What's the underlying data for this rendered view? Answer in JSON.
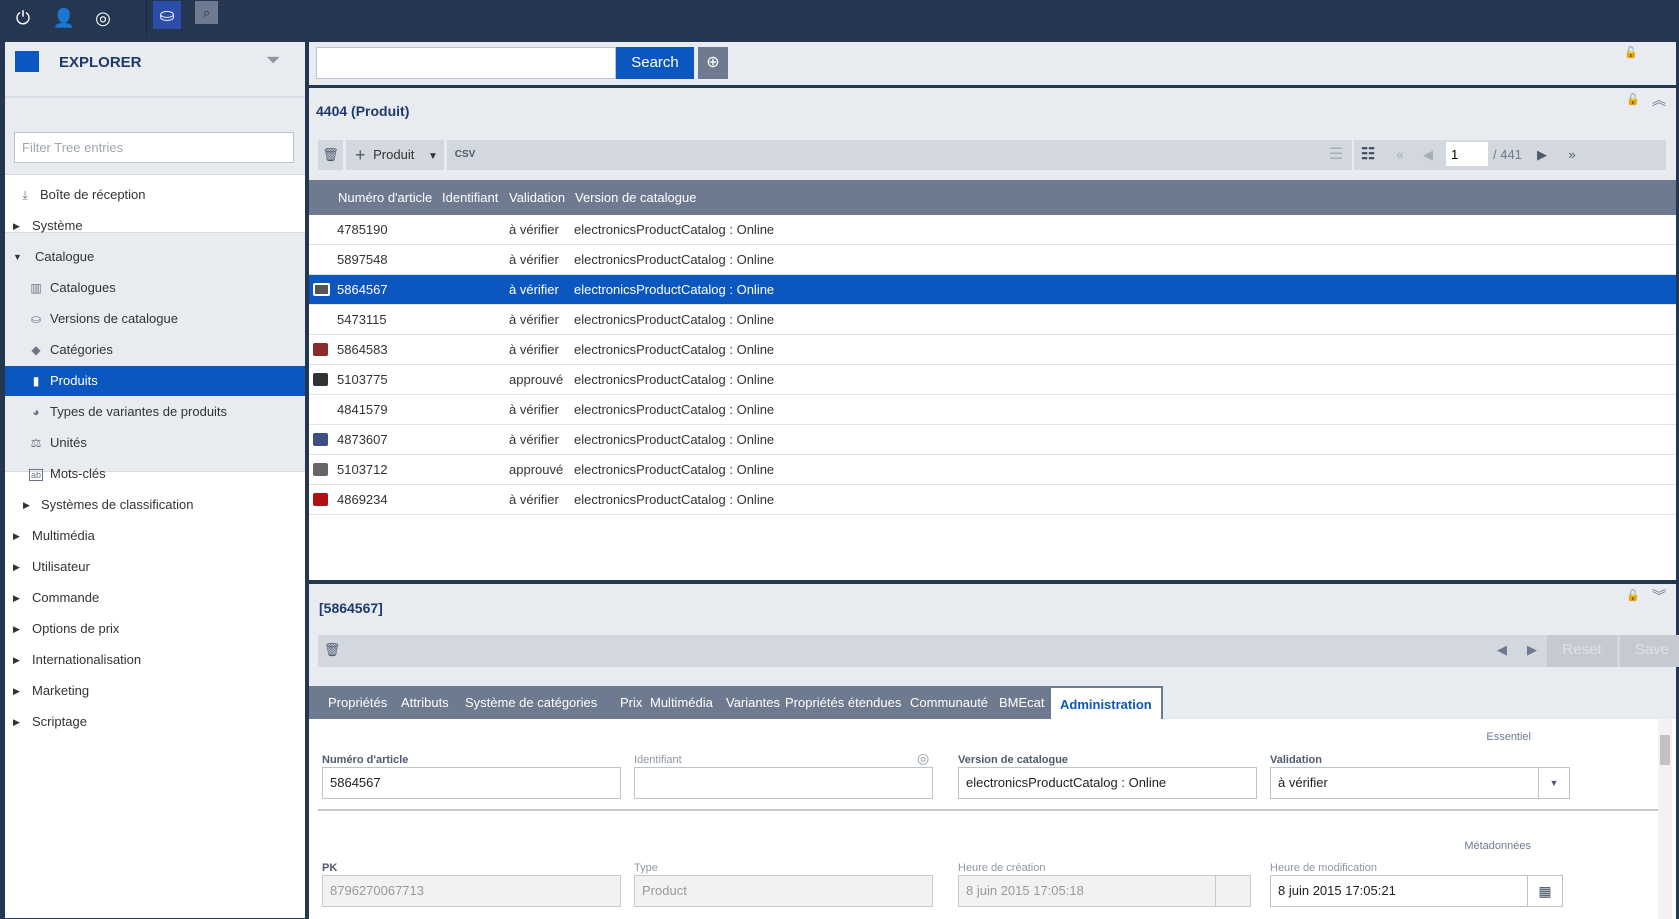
{
  "topbar": {
    "icons": [
      "power-icon",
      "user-icon",
      "globe-icon",
      "backoffice-perspective-icon",
      "search-perspective-icon"
    ]
  },
  "sidebar": {
    "title": "EXPLORER",
    "filter_placeholder": "Filter Tree entries",
    "items": [
      {
        "label": "Boîte de réception",
        "icon": "inbox-icon",
        "level": 0
      },
      {
        "label": "Système",
        "level": 0,
        "expanded": false
      },
      {
        "label": "Catalogue",
        "level": 0,
        "expanded": true
      },
      {
        "label": "Catalogues",
        "icon": "catalogs-icon",
        "level": 1
      },
      {
        "label": "Versions de catalogue",
        "icon": "catalog-version-icon",
        "level": 1
      },
      {
        "label": "Catégories",
        "icon": "tag-icon",
        "level": 1
      },
      {
        "label": "Produits",
        "icon": "product-icon",
        "level": 1,
        "selected": true
      },
      {
        "label": "Types de variantes de produits",
        "icon": "variant-types-icon",
        "level": 1
      },
      {
        "label": "Unités",
        "icon": "units-icon",
        "level": 1
      },
      {
        "label": "Mots-clés",
        "icon": "keywords-icon",
        "level": 1
      },
      {
        "label": "Systèmes de classification",
        "level": 1,
        "expanded": false
      },
      {
        "label": "Multimédia",
        "level": 0,
        "expanded": false
      },
      {
        "label": "Utilisateur",
        "level": 0,
        "expanded": false
      },
      {
        "label": "Commande",
        "level": 0,
        "expanded": false
      },
      {
        "label": "Options de prix",
        "level": 0,
        "expanded": false
      },
      {
        "label": "Internationalisation",
        "level": 0,
        "expanded": false
      },
      {
        "label": "Marketing",
        "level": 0,
        "expanded": false
      },
      {
        "label": "Scriptage",
        "level": 0,
        "expanded": false
      }
    ]
  },
  "search": {
    "value": "",
    "button": "Search"
  },
  "list": {
    "title": "4404 (Produit)",
    "create_label": "Produit",
    "page": "1",
    "total_pages": "/ 441",
    "columns": [
      "Numéro d'article",
      "Identifiant",
      "Validation",
      "Version de catalogue"
    ],
    "rows": [
      {
        "num": "4785190",
        "id": "",
        "validation": "à vérifier",
        "version": "electronicsProductCatalog : Online",
        "thumb": ""
      },
      {
        "num": "5897548",
        "id": "",
        "validation": "à vérifier",
        "version": "electronicsProductCatalog : Online",
        "thumb": ""
      },
      {
        "num": "5864567",
        "id": "",
        "validation": "à vérifier",
        "version": "electronicsProductCatalog : Online",
        "thumb": "#555",
        "selected": true
      },
      {
        "num": "5473115",
        "id": "",
        "validation": "à vérifier",
        "version": "electronicsProductCatalog : Online",
        "thumb": ""
      },
      {
        "num": "5864583",
        "id": "",
        "validation": "à vérifier",
        "version": "electronicsProductCatalog : Online",
        "thumb": "#8a2a2a"
      },
      {
        "num": "5103775",
        "id": "",
        "validation": "approuvé",
        "version": "electronicsProductCatalog : Online",
        "thumb": "#333"
      },
      {
        "num": "4841579",
        "id": "",
        "validation": "à vérifier",
        "version": "electronicsProductCatalog : Online",
        "thumb": ""
      },
      {
        "num": "4873607",
        "id": "",
        "validation": "à vérifier",
        "version": "electronicsProductCatalog : Online",
        "thumb": "#3d4f80"
      },
      {
        "num": "5103712",
        "id": "",
        "validation": "approuvé",
        "version": "electronicsProductCatalog : Online",
        "thumb": "#666"
      },
      {
        "num": "4869234",
        "id": "",
        "validation": "à vérifier",
        "version": "electronicsProductCatalog : Online",
        "thumb": "#b01010"
      }
    ]
  },
  "detail": {
    "title": "[5864567]",
    "reset": "Reset",
    "save": "Save",
    "tabs": [
      "Propriétés",
      "Attributs",
      "Système de catégories",
      "Prix",
      "Multimédia",
      "Variantes",
      "Propriétés étendues",
      "Communauté",
      "BMEcat",
      "Administration"
    ],
    "active_tab": "Administration",
    "section_essential": "Essentiel",
    "section_meta": "Métadonnées",
    "fields": {
      "article_label": "Numéro d'article",
      "article_value": "5864567",
      "identifier_label": "Identifiant",
      "identifier_value": "",
      "version_label": "Version de catalogue",
      "version_value": "electronicsProductCatalog : Online",
      "validation_label": "Validation",
      "validation_value": "à vérifier",
      "pk_label": "PK",
      "pk_value": "8796270067713",
      "type_label": "Type",
      "type_value": "Product",
      "created_label": "Heure de création",
      "created_value": "8 juin 2015 17:05:18",
      "modified_label": "Heure de modification",
      "modified_value": "8 juin 2015 17:05:21"
    }
  },
  "colors": {
    "accent": "#0c57bf",
    "header": "#253750",
    "grid_header": "#6e7a90"
  }
}
